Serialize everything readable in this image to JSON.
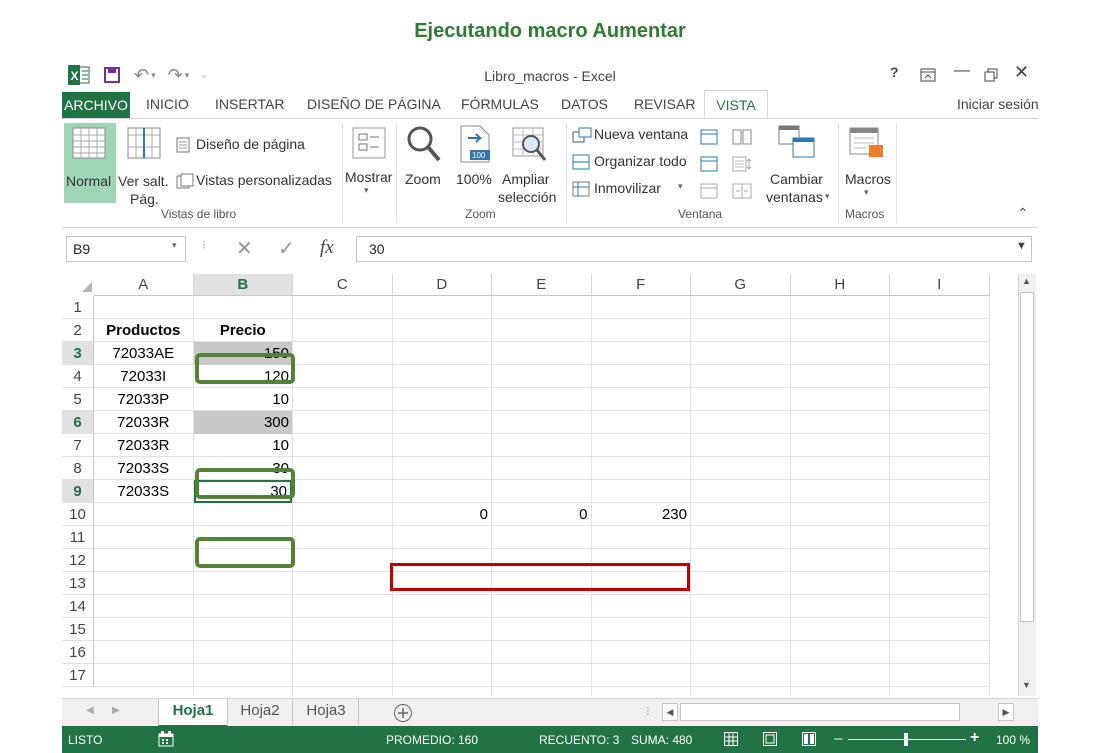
{
  "slide": {
    "title": "Ejecutando macro Aumentar"
  },
  "window": {
    "title": "Libro_macros - Excel",
    "help": "?",
    "signin": "Iniciar sesión"
  },
  "tabs": [
    "ARCHIVO",
    "INICIO",
    "INSERTAR",
    "DISEÑO DE PÁGINA",
    "FÓRMULAS",
    "DATOS",
    "REVISAR",
    "VISTA"
  ],
  "ribbon": {
    "normal": "Normal",
    "ver_salt_1": "Ver salt.",
    "ver_salt_2": "Pág.",
    "diseno_pagina": "Diseño de página",
    "vistas_personalizadas": "Vistas personalizadas",
    "grupo_vistas": "Vistas de libro",
    "mostrar": "Mostrar",
    "zoom": "Zoom",
    "zoom100": "100%",
    "ampliar_1": "Ampliar",
    "ampliar_2": "selección",
    "grupo_zoom": "Zoom",
    "nueva_ventana": "Nueva ventana",
    "organizar_todo": "Organizar todo",
    "inmovilizar": "Inmovilizar",
    "cambiar_1": "Cambiar",
    "cambiar_2": "ventanas",
    "grupo_ventana": "Ventana",
    "macros": "Macros",
    "grupo_macros": "Macros"
  },
  "formula_bar": {
    "name_box": "B9",
    "fx": "fx",
    "value": "30"
  },
  "columns": [
    "A",
    "B",
    "C",
    "D",
    "E",
    "F",
    "G",
    "H",
    "I"
  ],
  "rows": [
    "1",
    "2",
    "3",
    "4",
    "5",
    "6",
    "7",
    "8",
    "9",
    "10",
    "11",
    "12",
    "13",
    "14",
    "15",
    "16",
    "17"
  ],
  "cells": {
    "A2": "Productos",
    "B2": "Precio",
    "A3": "72033AE",
    "B3": "150",
    "A4": "72033I",
    "B4": "120",
    "A5": "72033P",
    "B5": "10",
    "A6": "72033R",
    "B6": "300",
    "A7": "72033R",
    "B7": "10",
    "A8": "72033S",
    "B8": "30",
    "A9": "72033S",
    "B9": "30",
    "D10": "0",
    "E10": "0",
    "F10": "230"
  },
  "sheets": [
    "Hoja1",
    "Hoja2",
    "Hoja3"
  ],
  "status": {
    "ready": "LISTO",
    "average": "PROMEDIO: 160",
    "count": "RECUENTO: 3",
    "sum": "SUMA: 480",
    "zoom": "100 %"
  },
  "colors": {
    "excel_green": "#217346",
    "highlight_green": "#548235",
    "highlight_red": "#c00000",
    "gray_fill": "#c9c9c9"
  }
}
